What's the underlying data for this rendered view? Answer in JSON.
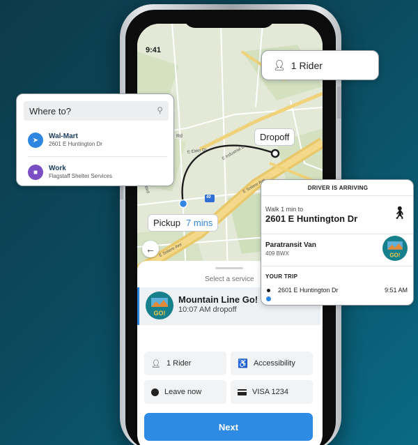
{
  "status_bar": {
    "time": "9:41"
  },
  "map": {
    "dropoff_label": "Dropoff",
    "pickup_label": "Pickup",
    "pickup_eta": "7 mins",
    "road_labels": [
      "Rd",
      "E Elder Dr",
      "E Industrial Dr",
      "E Soliere Ave",
      "E Soliere Ave",
      "Bird",
      "40"
    ]
  },
  "rider_card": {
    "icon": "add-person-icon",
    "label": "1 Rider"
  },
  "where_card": {
    "placeholder": "Where to?",
    "places": [
      {
        "name": "Wal-Mart",
        "address": "2601 E Huntington Dr",
        "icon": "navigation-arrow-icon",
        "color": "#2f86e0"
      },
      {
        "name": "Work",
        "address": "Flagstaff Shelter Services",
        "icon": "briefcase-icon",
        "color": "#7a4fc3"
      }
    ]
  },
  "driver_card": {
    "header": "DRIVER IS ARRIVING",
    "walk_text": "Walk 1 min to",
    "address": "2601 E Huntington Dr",
    "vehicle": "Paratransit Van",
    "plate": "409 BWX",
    "trip_label": "YOUR TRIP",
    "stop": "2601 E Huntington Dr",
    "stop_time": "9:51 AM"
  },
  "sheet": {
    "select_label": "Select a service",
    "service": {
      "name": "Mountain Line Go!",
      "subtitle": "10:07 AM dropoff",
      "logo_text": "GO!"
    },
    "options": {
      "riders": "1 Rider",
      "accessibility": "Accessibility",
      "leave": "Leave now",
      "payment": "VISA 1234"
    },
    "next_label": "Next"
  },
  "colors": {
    "accent": "#2f86e0",
    "work_icon": "#7a4fc3"
  }
}
